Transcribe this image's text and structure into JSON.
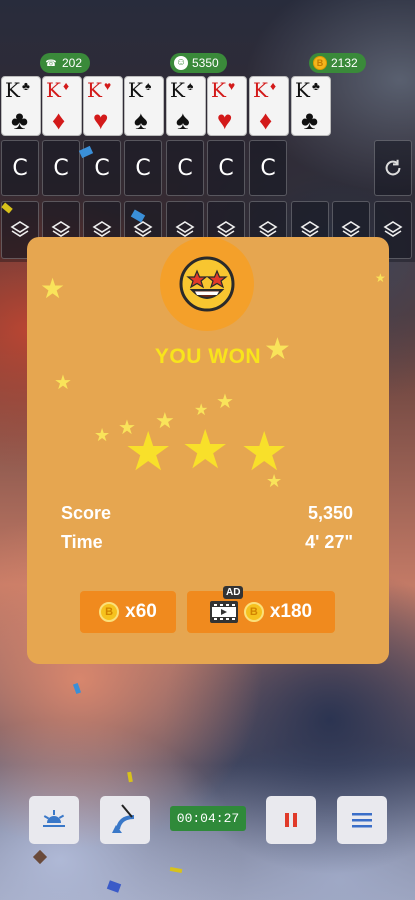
{
  "stats": {
    "moves": "202",
    "score": "5350",
    "coins": "2132"
  },
  "foundation": [
    {
      "rank": "K",
      "suit": "♣",
      "color": "black"
    },
    {
      "rank": "K",
      "suit": "♦",
      "color": "red"
    },
    {
      "rank": "K",
      "suit": "♥",
      "color": "red"
    },
    {
      "rank": "K",
      "suit": "♠",
      "color": "black"
    },
    {
      "rank": "K",
      "suit": "♠",
      "color": "black"
    },
    {
      "rank": "K",
      "suit": "♥",
      "color": "red"
    },
    {
      "rank": "K",
      "suit": "♦",
      "color": "red"
    },
    {
      "rank": "K",
      "suit": "♣",
      "color": "black"
    }
  ],
  "slot_letter": "C",
  "dialog": {
    "title": "YOU WON",
    "score_label": "Score",
    "score_value": "5,350",
    "time_label": "Time",
    "time_value": "4' 27\"",
    "stars_earned": 3,
    "reward_multiplier": "x60",
    "ad_reward_multiplier": "x180",
    "ad_badge": "AD",
    "coin_symbol": "B"
  },
  "toolbar": {
    "timer": "00:04:27"
  },
  "icons": {
    "moves": "phone-icon",
    "score": "smiley-icon",
    "coins": "coin-icon",
    "refresh": "refresh-icon",
    "stack": "layers-icon",
    "sunrise": "sunrise-icon",
    "undo": "undo-icon",
    "pause": "pause-icon",
    "menu": "menu-icon"
  },
  "colors": {
    "dialog_bg": "#e6a650",
    "accent_orange": "#f08a1e",
    "title_yellow": "#f8e41c",
    "green": "#3a8a3a",
    "pause_red": "#e03a2a",
    "menu_blue": "#3a6ec8"
  }
}
